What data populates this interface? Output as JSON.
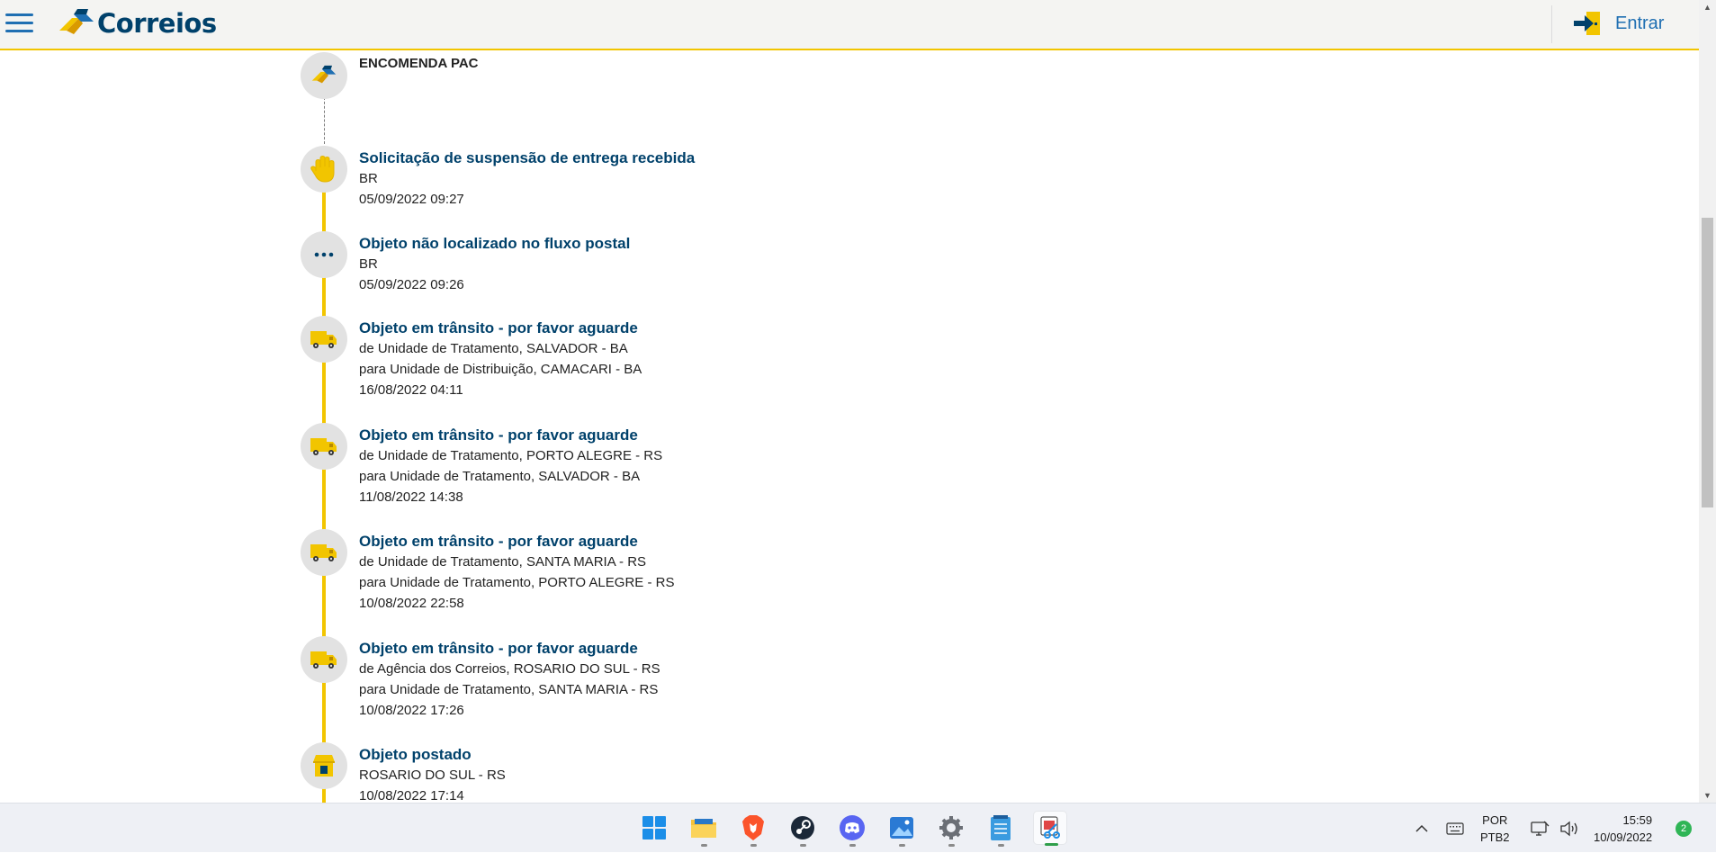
{
  "header": {
    "brand": "Correios",
    "login_label": "Entrar"
  },
  "product": "ENCOMENDA PAC",
  "events": [
    {
      "icon": "hand-stop-icon",
      "title": "Solicitação de suspensão de entrega recebida",
      "lines": [
        "BR",
        "05/09/2022 09:27"
      ]
    },
    {
      "icon": "ellipsis-icon",
      "title": "Objeto não localizado no fluxo postal",
      "lines": [
        "BR",
        "05/09/2022 09:26"
      ]
    },
    {
      "icon": "truck-icon",
      "title": "Objeto em trânsito - por favor aguarde",
      "lines": [
        "de Unidade de Tratamento, SALVADOR - BA",
        "para Unidade de Distribuição, CAMACARI - BA",
        "16/08/2022 04:11"
      ]
    },
    {
      "icon": "truck-icon",
      "title": "Objeto em trânsito - por favor aguarde",
      "lines": [
        "de Unidade de Tratamento, PORTO ALEGRE - RS",
        "para Unidade de Tratamento, SALVADOR - BA",
        "11/08/2022 14:38"
      ]
    },
    {
      "icon": "truck-icon",
      "title": "Objeto em trânsito - por favor aguarde",
      "lines": [
        "de Unidade de Tratamento, SANTA MARIA - RS",
        "para Unidade de Tratamento, PORTO ALEGRE - RS",
        "10/08/2022 22:58"
      ]
    },
    {
      "icon": "truck-icon",
      "title": "Objeto em trânsito - por favor aguarde",
      "lines": [
        "de Agência dos Correios, ROSARIO DO SUL - RS",
        "para Unidade de Tratamento, SANTA MARIA - RS",
        "10/08/2022 17:26"
      ]
    },
    {
      "icon": "post-office-icon",
      "title": "Objeto postado",
      "lines": [
        "ROSARIO DO SUL - RS",
        "10/08/2022 17:14"
      ]
    }
  ],
  "taskbar": {
    "apps": [
      "start-icon",
      "file-explorer-icon",
      "brave-icon",
      "steam-icon",
      "discord-icon",
      "photos-icon",
      "settings-icon",
      "notepad-icon",
      "snipping-tool-icon"
    ],
    "language_line1": "POR",
    "language_line2": "PTB2",
    "time": "15:59",
    "date": "10/09/2022",
    "notification_count": "2"
  },
  "colors": {
    "brand_blue": "#00416b",
    "brand_yellow": "#f2c500",
    "link_blue": "#1f6fb2"
  }
}
